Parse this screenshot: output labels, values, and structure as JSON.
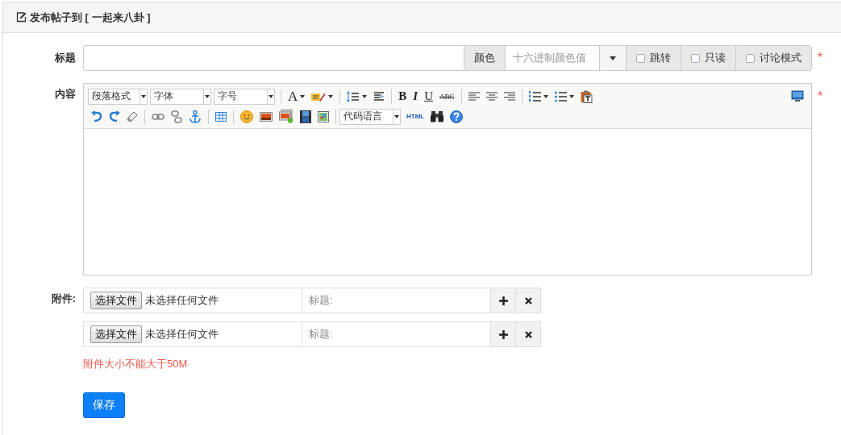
{
  "header": {
    "title": "发布帖子到 [ 一起来八卦 ]"
  },
  "title_row": {
    "label": "标题",
    "color_label": "颜色",
    "color_placeholder": "十六进制颜色值",
    "required": "*",
    "options": [
      {
        "label": "跳转",
        "checked": false
      },
      {
        "label": "只读",
        "checked": false
      },
      {
        "label": "讨论模式",
        "checked": false
      }
    ]
  },
  "content_row": {
    "label": "内容",
    "required": "*",
    "toolbar": [
      [
        {
          "kind": "select",
          "label": "段落格式"
        },
        {
          "kind": "select",
          "label": "字体"
        },
        {
          "kind": "select",
          "label": "字号"
        },
        {
          "kind": "sep"
        },
        {
          "kind": "fontcolor",
          "text": "A"
        },
        {
          "kind": "highlight"
        },
        {
          "kind": "sep"
        },
        {
          "kind": "lineheight"
        },
        {
          "kind": "indent"
        },
        {
          "kind": "sep"
        },
        {
          "kind": "bold",
          "text": "B"
        },
        {
          "kind": "italic",
          "text": "I"
        },
        {
          "kind": "underline",
          "text": "U"
        },
        {
          "kind": "strike",
          "text": "ABC"
        },
        {
          "kind": "sep"
        },
        {
          "kind": "alignleft"
        },
        {
          "kind": "aligncenter"
        },
        {
          "kind": "alignright"
        },
        {
          "kind": "sep"
        },
        {
          "kind": "ol"
        },
        {
          "kind": "ul"
        },
        {
          "kind": "paste"
        },
        {
          "kind": "spacer"
        },
        {
          "kind": "preview"
        }
      ],
      [
        {
          "kind": "undo"
        },
        {
          "kind": "redo"
        },
        {
          "kind": "eraser"
        },
        {
          "kind": "sep"
        },
        {
          "kind": "link"
        },
        {
          "kind": "unlink"
        },
        {
          "kind": "anchor"
        },
        {
          "kind": "sep"
        },
        {
          "kind": "table"
        },
        {
          "kind": "sep"
        },
        {
          "kind": "emoji"
        },
        {
          "kind": "image"
        },
        {
          "kind": "gallery"
        },
        {
          "kind": "video"
        },
        {
          "kind": "map"
        },
        {
          "kind": "sep"
        },
        {
          "kind": "select",
          "label": "代码语言"
        },
        {
          "kind": "html",
          "text": "HTML"
        },
        {
          "kind": "search"
        },
        {
          "kind": "help"
        }
      ]
    ]
  },
  "attachments": {
    "label": "附件:",
    "rows": [
      {
        "button": "选择文件",
        "status": "未选择任何文件",
        "title_placeholder": "标题:"
      },
      {
        "button": "选择文件",
        "status": "未选择任何文件",
        "title_placeholder": "标题:"
      }
    ]
  },
  "note": "附件大小不能大于50M",
  "save": "保存"
}
